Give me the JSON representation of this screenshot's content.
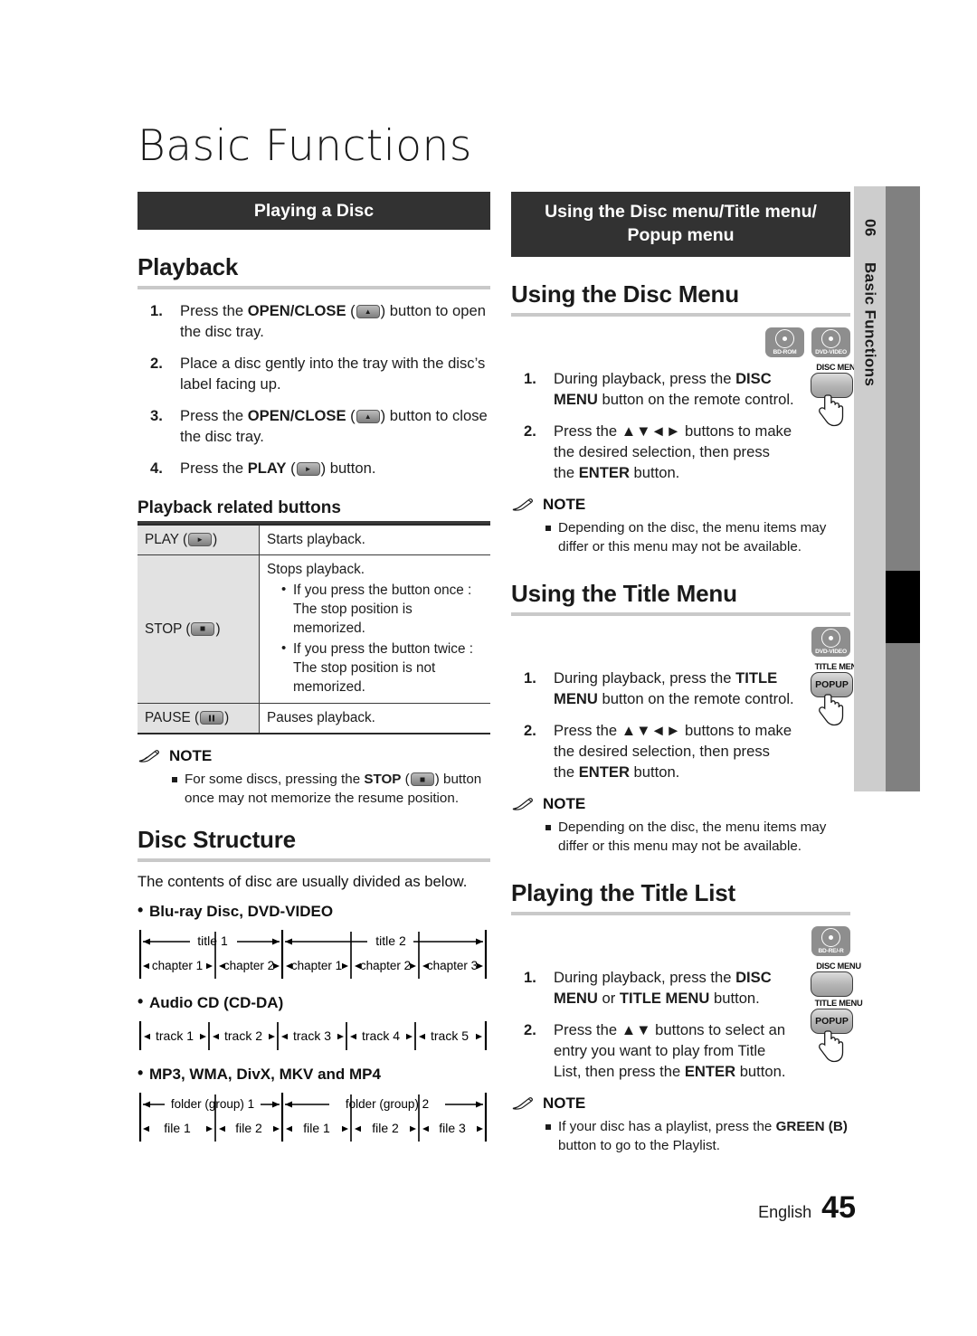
{
  "chapter": {
    "title": "Basic Functions"
  },
  "side_tab": {
    "number": "06",
    "label": "Basic Functions"
  },
  "footer": {
    "language": "English",
    "page": "45"
  },
  "left": {
    "banner": "Playing a Disc",
    "playback": {
      "heading": "Playback",
      "steps": [
        {
          "num": "1.",
          "pre": "Press the ",
          "bold": "OPEN/CLOSE",
          "mid": " (",
          "key": "eject",
          "post": ") button to open the disc tray."
        },
        {
          "num": "2.",
          "pre": "Place a disc gently into the tray with the disc’s label facing up.",
          "bold": "",
          "mid": "",
          "key": "",
          "post": ""
        },
        {
          "num": "3.",
          "pre": "Press the ",
          "bold": "OPEN/CLOSE",
          "mid": " (",
          "key": "eject",
          "post": ") button to close the disc tray."
        },
        {
          "num": "4.",
          "pre": "Press the ",
          "bold": "PLAY",
          "mid": " (",
          "key": "play",
          "post": ") button."
        }
      ]
    },
    "related": {
      "heading": "Playback related buttons",
      "rows": [
        {
          "key_label": "PLAY (",
          "key_icon": "play",
          "key_tail": ")",
          "text": "Starts playback.",
          "bullets": []
        },
        {
          "key_label": "STOP (",
          "key_icon": "stop",
          "key_tail": ")",
          "text": "Stops playback.",
          "bullets": [
            "If you press the button once : The stop position is memorized.",
            "If you press the button twice : The stop position is not memorized."
          ]
        },
        {
          "key_label": "PAUSE (",
          "key_icon": "pause",
          "key_tail": ")",
          "text": "Pauses playback.",
          "bullets": []
        }
      ]
    },
    "note": {
      "title": "NOTE",
      "items": [
        {
          "pre": "For some discs, pressing the ",
          "bold": "STOP",
          "mid": " (",
          "key": "stop",
          "post": ")  button once may not memorize the resume position."
        }
      ]
    },
    "disc_structure": {
      "heading": "Disc Structure",
      "intro": "The contents of disc are usually divided as below.",
      "groups": [
        {
          "label": "Blu-ray Disc, DVD-VIDEO",
          "top_row": [
            "title 1",
            "title 2"
          ],
          "bottom_row": [
            "chapter 1",
            "chapter 2",
            "chapter 1",
            "chapter 2",
            "chapter 3"
          ],
          "top_spans": [
            2,
            3
          ]
        },
        {
          "label": "Audio CD (CD-DA)",
          "top_row": [],
          "bottom_row": [
            "track 1",
            "track 2",
            "track 3",
            "track 4",
            "track 5"
          ],
          "top_spans": []
        },
        {
          "label": "MP3, WMA, DivX, MKV and MP4",
          "top_row": [
            "folder (group) 1",
            "folder (group) 2"
          ],
          "bottom_row": [
            "file 1",
            "file 2",
            "file 1",
            "file 2",
            "file 3"
          ],
          "top_spans": [
            2,
            3
          ]
        }
      ]
    }
  },
  "right": {
    "banner_line1": "Using the Disc menu/Title menu/",
    "banner_line2": "Popup menu",
    "disc_menu": {
      "heading": "Using the Disc Menu",
      "badges": [
        "BD-ROM",
        "DVD-VIDEO"
      ],
      "remote_label": "DISC MENU",
      "steps": [
        {
          "num": "1.",
          "pre": "During playback, press the ",
          "bold": "DISC MENU",
          "post": " button on the remote control."
        },
        {
          "num": "2.",
          "pre": "Press the ▲▼◄► buttons to make the desired selection, then press the ",
          "bold": "ENTER",
          "post": " button."
        }
      ],
      "note": {
        "title": "NOTE",
        "items": [
          "Depending on the disc, the menu items may differ or this menu may not be available."
        ]
      }
    },
    "title_menu": {
      "heading": "Using the Title Menu",
      "badges": [
        "DVD-VIDEO"
      ],
      "remote_label": "TITLE MENU",
      "remote_key": "POPUP",
      "steps": [
        {
          "num": "1.",
          "pre": "During playback, press the ",
          "bold": "TITLE MENU",
          "post": " button on the remote control."
        },
        {
          "num": "2.",
          "pre": "Press the ▲▼◄► buttons to make the desired selection, then press the ",
          "bold": "ENTER",
          "post": " button."
        }
      ],
      "note": {
        "title": "NOTE",
        "items": [
          "Depending on the disc, the menu items may differ or this menu may not be available."
        ]
      }
    },
    "title_list": {
      "heading": "Playing the Title List",
      "badges": [
        "BD-RE/-R"
      ],
      "remote_label_1": "DISC MENU",
      "remote_label_2": "TITLE MENU",
      "remote_key": "POPUP",
      "steps": [
        {
          "num": "1.",
          "pre": "During playback, press the ",
          "bold": "DISC MENU",
          "mid": " or ",
          "bold2": "TITLE MENU",
          "post": " button."
        },
        {
          "num": "2.",
          "pre": "Press the ▲▼ buttons to select an entry you want to play from Title List, then press the ",
          "bold": "ENTER",
          "post": " button."
        }
      ],
      "note": {
        "title": "NOTE",
        "items_rich": [
          {
            "pre": "If your disc has a playlist, press the ",
            "bold": "GREEN (B)",
            "post": " button to go to the Playlist."
          }
        ]
      }
    }
  }
}
